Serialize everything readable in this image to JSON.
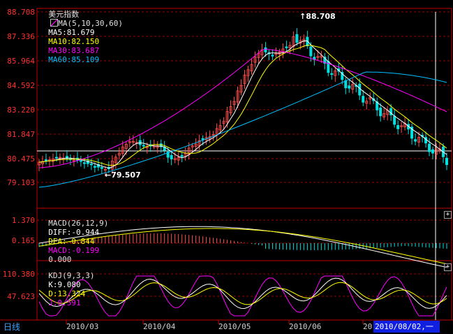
{
  "main": {
    "title": "美元指数",
    "ma_label": "MA(5,10,30,60)",
    "ma5": "MA5:81.679",
    "ma10": "MA10:82.150",
    "ma30": "MA30:83.687",
    "ma60": "MA60:85.109",
    "high_label": "88.708",
    "low_label": "79.507",
    "y_ticks": [
      "88.708",
      "87.336",
      "85.964",
      "84.592",
      "83.220",
      "81.847",
      "80.475",
      "79.103"
    ]
  },
  "macd": {
    "label": "MACD(26,12,9)",
    "diff": "DIFF:-0.944",
    "dea": "DEA:-0.844",
    "macd": "MACD:-0.199",
    "extra": "0.000",
    "y_ticks": [
      "1.370",
      "0.165"
    ]
  },
  "kdj": {
    "label": "KDJ(9,3,3)",
    "k": "K:9.080",
    "d": "D:13.324",
    "j": "J:0.591",
    "y_ticks": [
      "110.380",
      "47.623"
    ]
  },
  "x_axis": {
    "labels": [
      "2010/03",
      "2010/04",
      "2010/05",
      "2010/06",
      "20"
    ]
  },
  "period_tab": "日线",
  "cursor_date": "2010/08/02,一",
  "colors": {
    "up": "#ff5050",
    "down": "#00e0e0",
    "ma5": "#ffffff",
    "ma10": "#ffff00",
    "ma30": "#ff00ff",
    "ma60": "#00c0ff",
    "grid": "#a00000"
  }
}
